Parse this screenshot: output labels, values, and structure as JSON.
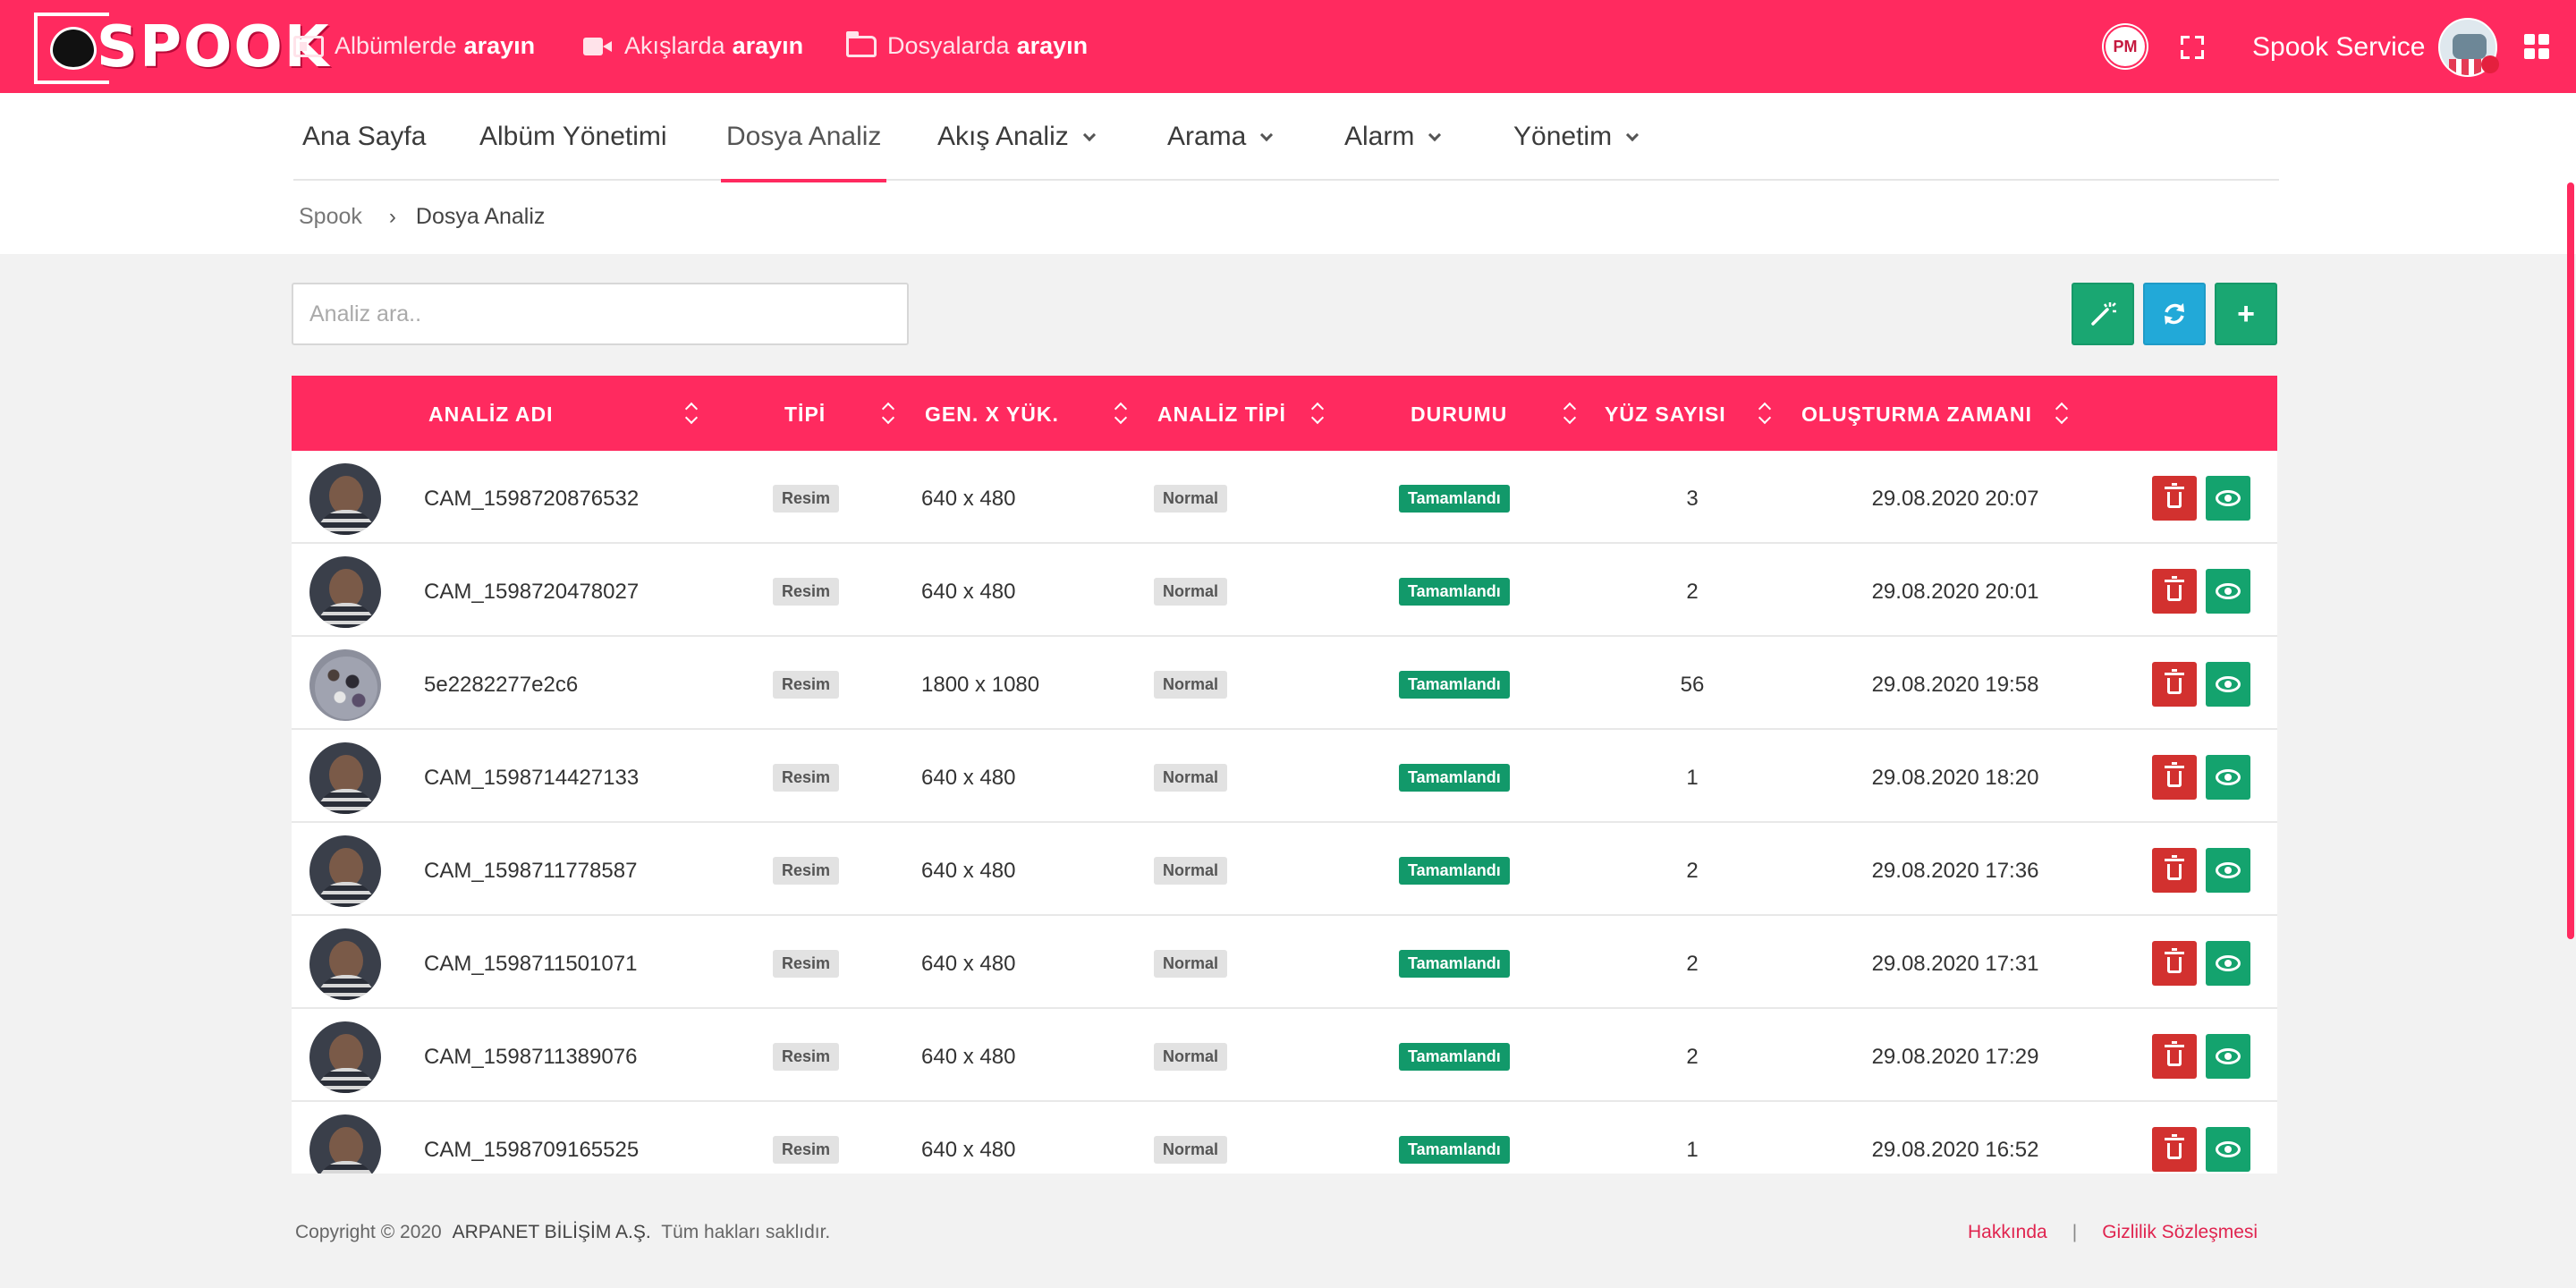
{
  "brand": {
    "name": "SPOOK"
  },
  "topbar": {
    "search_albums": {
      "prefix": "Albümlerde",
      "bold": "arayın",
      "icon": "id-card-icon"
    },
    "search_streams": {
      "prefix": "Akışlarda",
      "bold": "arayın",
      "icon": "video-camera-icon"
    },
    "search_files": {
      "prefix": "Dosyalarda",
      "bold": "arayın",
      "icon": "folder-open-icon"
    },
    "pm_badge": "PM",
    "user_name": "Spook Service",
    "accent_color": "#ff2a5f"
  },
  "nav": {
    "items": [
      {
        "label": "Ana Sayfa",
        "dropdown": false
      },
      {
        "label": "Albüm Yönetimi",
        "dropdown": false
      },
      {
        "label": "Dosya Analiz",
        "dropdown": false,
        "active": true
      },
      {
        "label": "Akış Analiz",
        "dropdown": true
      },
      {
        "label": "Arama",
        "dropdown": true
      },
      {
        "label": "Alarm",
        "dropdown": true
      },
      {
        "label": "Yönetim",
        "dropdown": true
      }
    ]
  },
  "breadcrumb": {
    "root": "Spook",
    "separator": "›",
    "current": "Dosya Analiz"
  },
  "search": {
    "placeholder": "Analiz ara..",
    "value": ""
  },
  "actions": {
    "add_label": "+"
  },
  "table": {
    "headers": {
      "name": "ANALİZ ADI",
      "type": "TİPİ",
      "dims": "GEN. X YÜK.",
      "analysis_type": "ANALİZ TİPİ",
      "status": "DURUMU",
      "face_count": "YÜZ SAYISI",
      "created": "OLUŞTURMA ZAMANI"
    },
    "rows": [
      {
        "name": "CAM_1598720876532",
        "type": "Resim",
        "dims": "640 x 480",
        "analysis_type": "Normal",
        "status": "Tamamlandı",
        "face_count": "3",
        "created": "29.08.2020 20:07"
      },
      {
        "name": "CAM_1598720478027",
        "type": "Resim",
        "dims": "640 x 480",
        "analysis_type": "Normal",
        "status": "Tamamlandı",
        "face_count": "2",
        "created": "29.08.2020 20:01"
      },
      {
        "name": "5e2282277e2c6",
        "type": "Resim",
        "dims": "1800 x 1080",
        "analysis_type": "Normal",
        "status": "Tamamlandı",
        "face_count": "56",
        "created": "29.08.2020 19:58"
      },
      {
        "name": "CAM_1598714427133",
        "type": "Resim",
        "dims": "640 x 480",
        "analysis_type": "Normal",
        "status": "Tamamlandı",
        "face_count": "1",
        "created": "29.08.2020 18:20"
      },
      {
        "name": "CAM_1598711778587",
        "type": "Resim",
        "dims": "640 x 480",
        "analysis_type": "Normal",
        "status": "Tamamlandı",
        "face_count": "2",
        "created": "29.08.2020 17:36"
      },
      {
        "name": "CAM_1598711501071",
        "type": "Resim",
        "dims": "640 x 480",
        "analysis_type": "Normal",
        "status": "Tamamlandı",
        "face_count": "2",
        "created": "29.08.2020 17:31"
      },
      {
        "name": "CAM_1598711389076",
        "type": "Resim",
        "dims": "640 x 480",
        "analysis_type": "Normal",
        "status": "Tamamlandı",
        "face_count": "2",
        "created": "29.08.2020 17:29"
      },
      {
        "name": "CAM_1598709165525",
        "type": "Resim",
        "dims": "640 x 480",
        "analysis_type": "Normal",
        "status": "Tamamlandı",
        "face_count": "1",
        "created": "29.08.2020 16:52"
      }
    ]
  },
  "footer": {
    "copyright": "Copyright © 2020",
    "company": "ARPANET BİLİŞİM A.Ş.",
    "rights": "Tüm hakları saklıdır.",
    "about": "Hakkında",
    "separator": "|",
    "privacy": "Gizlilik Sözleşmesi"
  }
}
